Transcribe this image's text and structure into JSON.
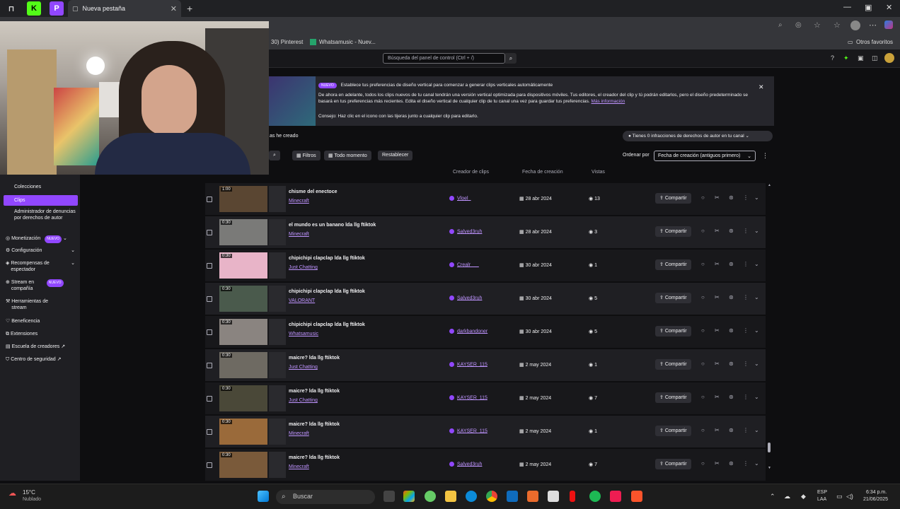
{
  "browser": {
    "tab_title": "Nueva pestaña",
    "bookmarks": [
      "30) Pinterest",
      "Whatsamusic - Nuev...",
      "Otros favoritos"
    ]
  },
  "twitch": {
    "search_placeholder": "Búsqueda del panel de control (Ctrl + /)"
  },
  "sidebar": {
    "items": [
      {
        "label": "Colecciones"
      },
      {
        "label": "Clips"
      },
      {
        "label": "Administrador de denuncias por derechos de autor"
      },
      {
        "label": "Monetización",
        "badge": "NUEVO"
      },
      {
        "label": "Configuración"
      },
      {
        "label": "Recompensas de espectador"
      },
      {
        "label": "Stream en compañía",
        "badge": "NUEVO"
      },
      {
        "label": "Herramientas de stream"
      },
      {
        "label": "Beneficencia"
      },
      {
        "label": "Extensiones"
      },
      {
        "label": "Escuela de creadores"
      },
      {
        "label": "Centro de seguridad"
      }
    ]
  },
  "banner": {
    "badge": "NUEVO",
    "headline": "Establece tus preferencias de diseño vertical para comenzar a generar clips verticales automáticamente",
    "body": "De ahora en adelante, todos los clips nuevos de tu canal tendrán una versión vertical optimizada para dispositivos móviles. Tus editores, el creador del clip y tú podrán editarlos, pero el diseño predeterminado se basará en tus preferencias más recientes. Edita el diseño vertical de cualquier clip de tu canal una vez para guardar tus preferencias.",
    "link": "Más información",
    "hint": "Consejo: Haz clic en el icono con las tijeras junto a cualquier clip para editarlo."
  },
  "section_label": "as he creado",
  "infractions": "Tienes 0 infracciones de derechos de autor en tu canal",
  "toolbar": {
    "filters": "Filtros",
    "period": "Todo momento",
    "reset": "Restablecer",
    "sort_label": "Ordenar por",
    "sort_value": "Fecha de creación (antiguos primero)"
  },
  "columns": {
    "creator": "Creador de clips",
    "date": "Fecha de creación",
    "views": "Vistas"
  },
  "share_label": "Compartir",
  "clips": [
    {
      "duration": "1:00",
      "title": "chisme del enectoce",
      "game": "Minecraft",
      "creator": "Vloel_",
      "date": "28 abr 2024",
      "views": "13"
    },
    {
      "duration": "0:30",
      "title": "el mundo es un banano lda llg ftiktok",
      "game": "Minecraft",
      "creator": "Salyed3ruh",
      "date": "28 abr 2024",
      "views": "3"
    },
    {
      "duration": "0:30",
      "title": "chipichipi clapclap lda llg ftiktok",
      "game": "Just Chatting",
      "creator": "Crealr___",
      "date": "30 abr 2024",
      "views": "1"
    },
    {
      "duration": "0:30",
      "title": "chipichipi clapclap lda llg ftiktok",
      "game": "VALORANT",
      "creator": "Salyed3ruh",
      "date": "30 abr 2024",
      "views": "5"
    },
    {
      "duration": "0:30",
      "title": "chipichipi clapclap lda llg ftiktok",
      "game": "Whatsamusic",
      "creator": "darkbandoner",
      "date": "30 abr 2024",
      "views": "5"
    },
    {
      "duration": "0:30",
      "title": "maicre? lda llg ftiktok",
      "game": "Just Chatting",
      "creator": "KAYSER_115",
      "date": "2 may 2024",
      "views": "1"
    },
    {
      "duration": "0:30",
      "title": "maicre? lda llg ftiktok",
      "game": "Just Chatting",
      "creator": "KAYSER_115",
      "date": "2 may 2024",
      "views": "7"
    },
    {
      "duration": "0:30",
      "title": "maicre? lda llg ftiktok",
      "game": "Minecraft",
      "creator": "KAYSER_115",
      "date": "2 may 2024",
      "views": "1"
    },
    {
      "duration": "0:30",
      "title": "maicre? lda llg ftiktok",
      "game": "Minecraft",
      "creator": "Salyed3ruh",
      "date": "2 may 2024",
      "views": "7"
    }
  ],
  "taskbar": {
    "weather_temp": "15°C",
    "weather_desc": "Nublado",
    "search": "Buscar",
    "lang": "ESP",
    "region": "LAA",
    "time": "6:34 p.m.",
    "date": "21/06/2025"
  },
  "colors": {
    "accent": "#9147ff",
    "link": "#bf94ff",
    "bg": "#0e0e10"
  }
}
